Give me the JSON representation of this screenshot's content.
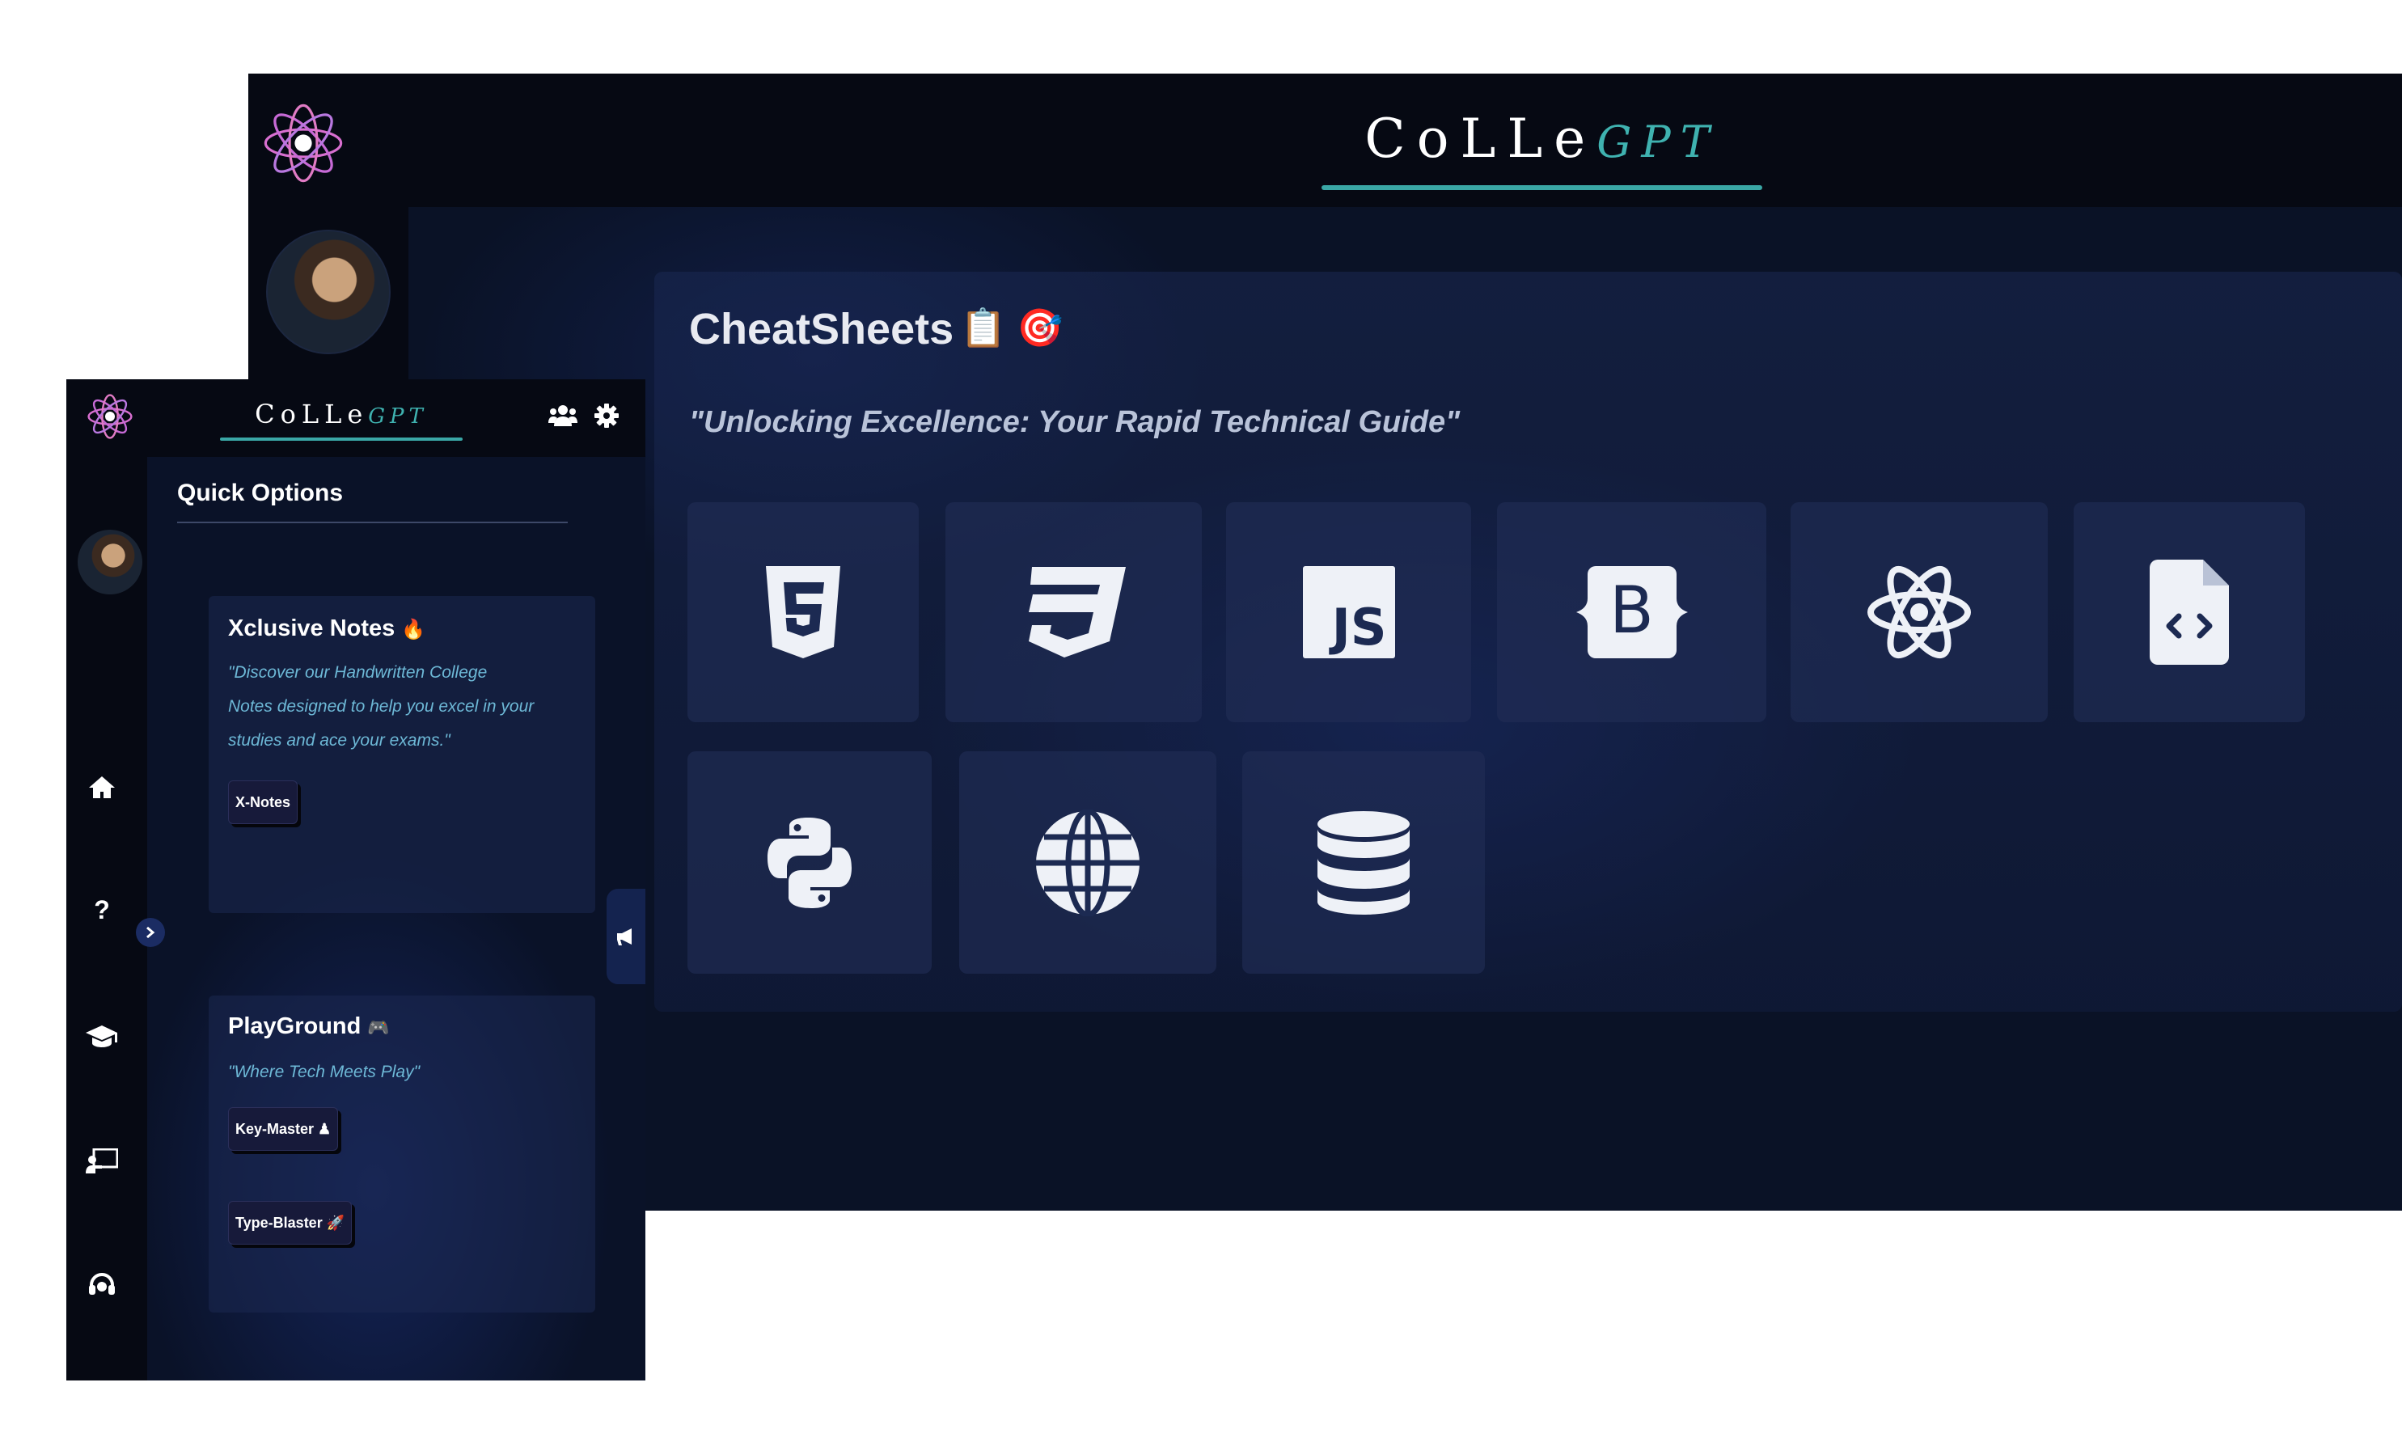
{
  "colors": {
    "accent_teal": "#3fb2b0",
    "bg_dark": "#060913",
    "bg_navy": "#0a1226",
    "card": "#1c2850"
  },
  "brand": {
    "part_a": "CoLLe",
    "part_b": "GPT"
  },
  "desktop": {
    "cheatsheets": {
      "title": "CheatSheets",
      "title_icons": "📋 🎯",
      "subtitle": "\"Unlocking Excellence: Your Rapid Technical Guide\"",
      "tiles": [
        {
          "icon": "html5-icon"
        },
        {
          "icon": "css3-icon"
        },
        {
          "icon": "javascript-icon"
        },
        {
          "icon": "bootstrap-icon"
        },
        {
          "icon": "react-icon"
        },
        {
          "icon": "file-code-icon"
        },
        {
          "icon": "python-icon"
        },
        {
          "icon": "globe-icon"
        },
        {
          "icon": "database-icon"
        }
      ],
      "js_label": "JS",
      "bootstrap_label": "B"
    }
  },
  "mobile": {
    "quick_options": "Quick Options",
    "nav_icons": [
      "home-icon",
      "question-icon",
      "graduation-cap-icon",
      "chalkboard-teacher-icon",
      "headset-icon"
    ],
    "question_glyph": "?",
    "xclusive": {
      "title": "Xclusive Notes",
      "title_emoji": "🔥",
      "desc_lines": [
        "\"Discover our Handwritten College",
        "Notes designed to help you excel in your",
        "studies and ace your exams.\""
      ],
      "button": "X-Notes"
    },
    "playground": {
      "title": "PlayGround",
      "title_emoji": "🎮",
      "desc": "\"Where Tech Meets Play\"",
      "buttons": [
        "Key-Master ♟",
        "Type-Blaster 🚀"
      ]
    }
  }
}
